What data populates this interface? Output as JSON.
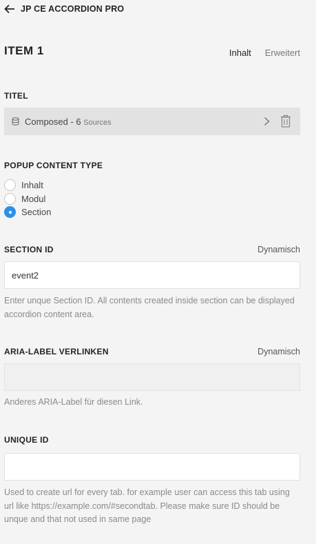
{
  "header": {
    "back_icon": "arrow-left-icon",
    "title": "JP CE ACCORDION PRO"
  },
  "item": {
    "title": "ITEM 1",
    "tabs": [
      {
        "label": "Inhalt",
        "active": true
      },
      {
        "label": "Erweitert",
        "active": false
      }
    ]
  },
  "titel": {
    "label": "TITEL",
    "source_icon": "database-icon",
    "source_text": "Composed - 6",
    "source_sub": "Sources",
    "chevron_icon": "chevron-right-icon",
    "delete_icon": "trash-icon"
  },
  "popup": {
    "label": "POPUP CONTENT TYPE",
    "options": [
      {
        "label": "Inhalt",
        "checked": false
      },
      {
        "label": "Modul",
        "checked": false
      },
      {
        "label": "Section",
        "checked": true
      }
    ]
  },
  "section_id": {
    "label": "SECTION ID",
    "dynamic_label": "Dynamisch",
    "value": "event2",
    "help": "Enter unque Section ID. All contents created inside section can be displayed accordion content area."
  },
  "aria": {
    "label": "ARIA-LABEL VERLINKEN",
    "dynamic_label": "Dynamisch",
    "value": "",
    "help": "Anderes ARIA-Label für diesen Link."
  },
  "unique_id": {
    "label": "UNIQUE ID",
    "value": "",
    "help": "Used to create url for every tab. for example user can access this tab using url like https://example.com/#secondtab. Please make sure ID should be unque and that not used in same page"
  },
  "colors": {
    "background": "#f4f4f4",
    "source_row": "#e2e2e2",
    "radio_checked": "#2f8ee8",
    "help_text": "#8a8a8a"
  }
}
